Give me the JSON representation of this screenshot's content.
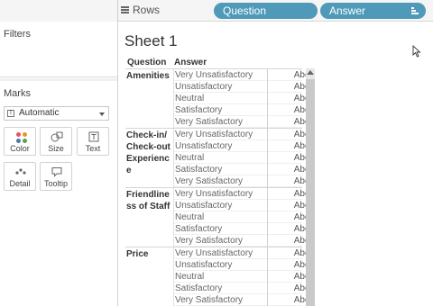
{
  "shelf": {
    "rows_label": "Rows",
    "pills": [
      {
        "label": "Question"
      },
      {
        "label": "Answer"
      }
    ]
  },
  "left_panel": {
    "filters_title": "Filters",
    "marks_title": "Marks",
    "mark_type": "Automatic",
    "mark_buttons": [
      {
        "label": "Color",
        "icon": "color-icon"
      },
      {
        "label": "Size",
        "icon": "size-icon"
      },
      {
        "label": "Text",
        "icon": "text-icon"
      },
      {
        "label": "Detail",
        "icon": "detail-icon"
      },
      {
        "label": "Tooltip",
        "icon": "tooltip-icon"
      }
    ]
  },
  "sheet": {
    "title": "Sheet 1",
    "headers": {
      "question": "Question",
      "answer": "Answer"
    },
    "groups": [
      {
        "question": "Amenities",
        "answers": [
          "Very Unsatisfactory",
          "Unsatisfactory",
          "Neutral",
          "Satisfactory",
          "Very Satisfactory"
        ],
        "values": [
          "Abc",
          "Abc",
          "Abc",
          "Abc",
          "Abc"
        ]
      },
      {
        "question": "Check-in/Check-out Experience",
        "answers": [
          "Very Unsatisfactory",
          "Unsatisfactory",
          "Neutral",
          "Satisfactory",
          "Very Satisfactory"
        ],
        "values": [
          "Abc",
          "Abc",
          "Abc",
          "Abc",
          "Abc"
        ]
      },
      {
        "question": "Friendliness of Staff",
        "answers": [
          "Very Unsatisfactory",
          "Unsatisfactory",
          "Neutral",
          "Satisfactory",
          "Very Satisfactory"
        ],
        "values": [
          "Abc",
          "Abc",
          "Abc",
          "Abc",
          "Abc"
        ]
      },
      {
        "question": "Price",
        "answers": [
          "Very Unsatisfactory",
          "Unsatisfactory",
          "Neutral",
          "Satisfactory",
          "Very Satisfactory"
        ],
        "values": [
          "Abc",
          "Abc",
          "Abc",
          "Abc",
          "Abc"
        ]
      }
    ]
  },
  "colors": {
    "pill": "#4e9ab8",
    "panel_bg": "#f5f5f5"
  }
}
